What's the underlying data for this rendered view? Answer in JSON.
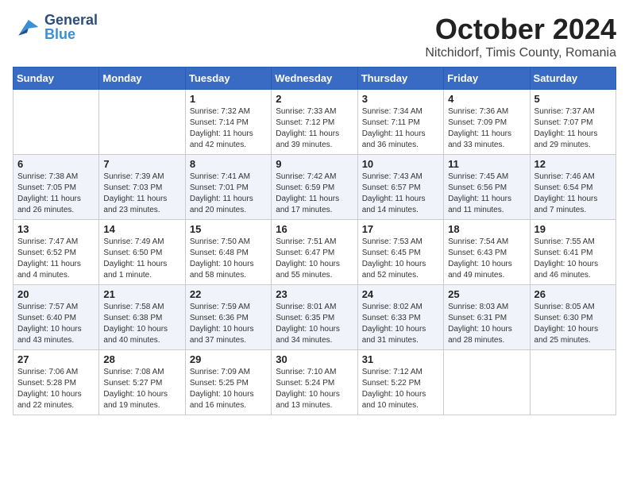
{
  "header": {
    "logo": {
      "general": "General",
      "blue": "Blue"
    },
    "month": "October 2024",
    "location": "Nitchidorf, Timis County, Romania"
  },
  "days_of_week": [
    "Sunday",
    "Monday",
    "Tuesday",
    "Wednesday",
    "Thursday",
    "Friday",
    "Saturday"
  ],
  "weeks": [
    [
      {
        "day": "",
        "info": ""
      },
      {
        "day": "",
        "info": ""
      },
      {
        "day": "1",
        "info": "Sunrise: 7:32 AM\nSunset: 7:14 PM\nDaylight: 11 hours and 42 minutes."
      },
      {
        "day": "2",
        "info": "Sunrise: 7:33 AM\nSunset: 7:12 PM\nDaylight: 11 hours and 39 minutes."
      },
      {
        "day": "3",
        "info": "Sunrise: 7:34 AM\nSunset: 7:11 PM\nDaylight: 11 hours and 36 minutes."
      },
      {
        "day": "4",
        "info": "Sunrise: 7:36 AM\nSunset: 7:09 PM\nDaylight: 11 hours and 33 minutes."
      },
      {
        "day": "5",
        "info": "Sunrise: 7:37 AM\nSunset: 7:07 PM\nDaylight: 11 hours and 29 minutes."
      }
    ],
    [
      {
        "day": "6",
        "info": "Sunrise: 7:38 AM\nSunset: 7:05 PM\nDaylight: 11 hours and 26 minutes."
      },
      {
        "day": "7",
        "info": "Sunrise: 7:39 AM\nSunset: 7:03 PM\nDaylight: 11 hours and 23 minutes."
      },
      {
        "day": "8",
        "info": "Sunrise: 7:41 AM\nSunset: 7:01 PM\nDaylight: 11 hours and 20 minutes."
      },
      {
        "day": "9",
        "info": "Sunrise: 7:42 AM\nSunset: 6:59 PM\nDaylight: 11 hours and 17 minutes."
      },
      {
        "day": "10",
        "info": "Sunrise: 7:43 AM\nSunset: 6:57 PM\nDaylight: 11 hours and 14 minutes."
      },
      {
        "day": "11",
        "info": "Sunrise: 7:45 AM\nSunset: 6:56 PM\nDaylight: 11 hours and 11 minutes."
      },
      {
        "day": "12",
        "info": "Sunrise: 7:46 AM\nSunset: 6:54 PM\nDaylight: 11 hours and 7 minutes."
      }
    ],
    [
      {
        "day": "13",
        "info": "Sunrise: 7:47 AM\nSunset: 6:52 PM\nDaylight: 11 hours and 4 minutes."
      },
      {
        "day": "14",
        "info": "Sunrise: 7:49 AM\nSunset: 6:50 PM\nDaylight: 11 hours and 1 minute."
      },
      {
        "day": "15",
        "info": "Sunrise: 7:50 AM\nSunset: 6:48 PM\nDaylight: 10 hours and 58 minutes."
      },
      {
        "day": "16",
        "info": "Sunrise: 7:51 AM\nSunset: 6:47 PM\nDaylight: 10 hours and 55 minutes."
      },
      {
        "day": "17",
        "info": "Sunrise: 7:53 AM\nSunset: 6:45 PM\nDaylight: 10 hours and 52 minutes."
      },
      {
        "day": "18",
        "info": "Sunrise: 7:54 AM\nSunset: 6:43 PM\nDaylight: 10 hours and 49 minutes."
      },
      {
        "day": "19",
        "info": "Sunrise: 7:55 AM\nSunset: 6:41 PM\nDaylight: 10 hours and 46 minutes."
      }
    ],
    [
      {
        "day": "20",
        "info": "Sunrise: 7:57 AM\nSunset: 6:40 PM\nDaylight: 10 hours and 43 minutes."
      },
      {
        "day": "21",
        "info": "Sunrise: 7:58 AM\nSunset: 6:38 PM\nDaylight: 10 hours and 40 minutes."
      },
      {
        "day": "22",
        "info": "Sunrise: 7:59 AM\nSunset: 6:36 PM\nDaylight: 10 hours and 37 minutes."
      },
      {
        "day": "23",
        "info": "Sunrise: 8:01 AM\nSunset: 6:35 PM\nDaylight: 10 hours and 34 minutes."
      },
      {
        "day": "24",
        "info": "Sunrise: 8:02 AM\nSunset: 6:33 PM\nDaylight: 10 hours and 31 minutes."
      },
      {
        "day": "25",
        "info": "Sunrise: 8:03 AM\nSunset: 6:31 PM\nDaylight: 10 hours and 28 minutes."
      },
      {
        "day": "26",
        "info": "Sunrise: 8:05 AM\nSunset: 6:30 PM\nDaylight: 10 hours and 25 minutes."
      }
    ],
    [
      {
        "day": "27",
        "info": "Sunrise: 7:06 AM\nSunset: 5:28 PM\nDaylight: 10 hours and 22 minutes."
      },
      {
        "day": "28",
        "info": "Sunrise: 7:08 AM\nSunset: 5:27 PM\nDaylight: 10 hours and 19 minutes."
      },
      {
        "day": "29",
        "info": "Sunrise: 7:09 AM\nSunset: 5:25 PM\nDaylight: 10 hours and 16 minutes."
      },
      {
        "day": "30",
        "info": "Sunrise: 7:10 AM\nSunset: 5:24 PM\nDaylight: 10 hours and 13 minutes."
      },
      {
        "day": "31",
        "info": "Sunrise: 7:12 AM\nSunset: 5:22 PM\nDaylight: 10 hours and 10 minutes."
      },
      {
        "day": "",
        "info": ""
      },
      {
        "day": "",
        "info": ""
      }
    ]
  ]
}
